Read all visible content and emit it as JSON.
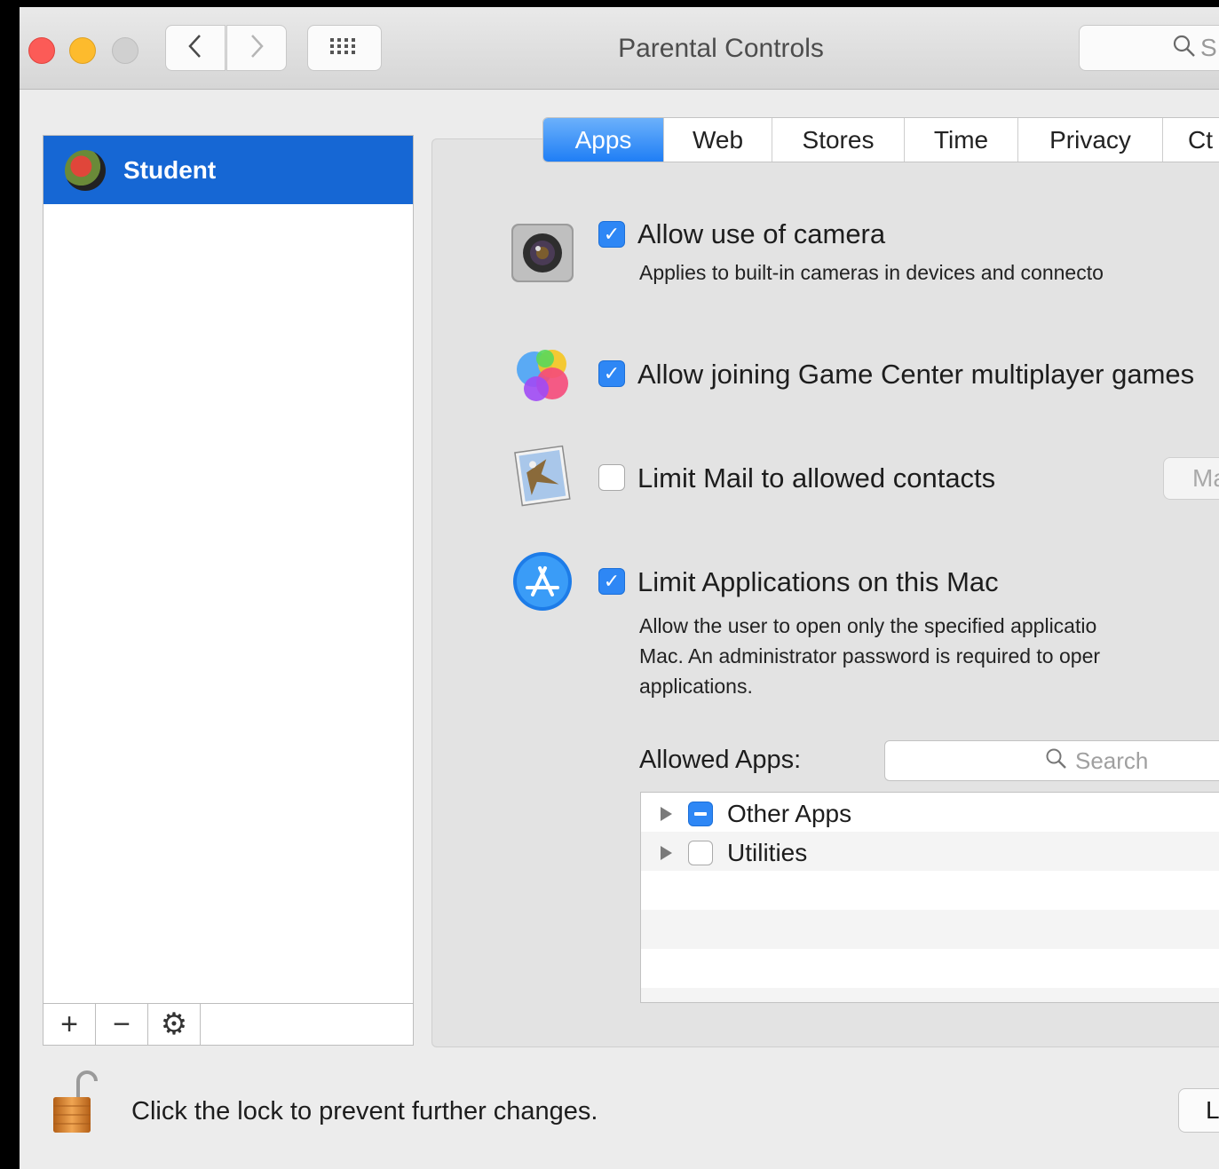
{
  "window": {
    "title": "Parental Controls",
    "search_placeholder": "S"
  },
  "sidebar": {
    "users": [
      {
        "name": "Student",
        "selected": true
      }
    ],
    "buttons": [
      "+",
      "−",
      "⚙"
    ]
  },
  "tabs": [
    {
      "label": "Apps",
      "active": true
    },
    {
      "label": "Web"
    },
    {
      "label": "Stores"
    },
    {
      "label": "Time"
    },
    {
      "label": "Privacy"
    },
    {
      "label": "Ct"
    }
  ],
  "settings": {
    "camera": {
      "label": "Allow use of camera",
      "description": "Applies to built-in cameras in devices and connecto",
      "checked": true
    },
    "game_center": {
      "label": "Allow joining Game Center multiplayer games",
      "checked": true
    },
    "mail": {
      "label": "Limit Mail to allowed contacts",
      "checked": false,
      "button_label": "Ma"
    },
    "apps": {
      "label": "Limit Applications on this Mac",
      "checked": true,
      "description_lines": [
        "Allow the user to open only the specified applicatio",
        "Mac. An administrator password is required to oper",
        "applications."
      ]
    }
  },
  "allowed_apps": {
    "label": "Allowed Apps:",
    "search_placeholder": "Search",
    "items": [
      {
        "name": "Other Apps",
        "state": "mixed"
      },
      {
        "name": "Utilities",
        "state": "unchecked"
      }
    ]
  },
  "footer": {
    "lock_text": "Click the lock to prevent further changes.",
    "button_label": "L"
  }
}
